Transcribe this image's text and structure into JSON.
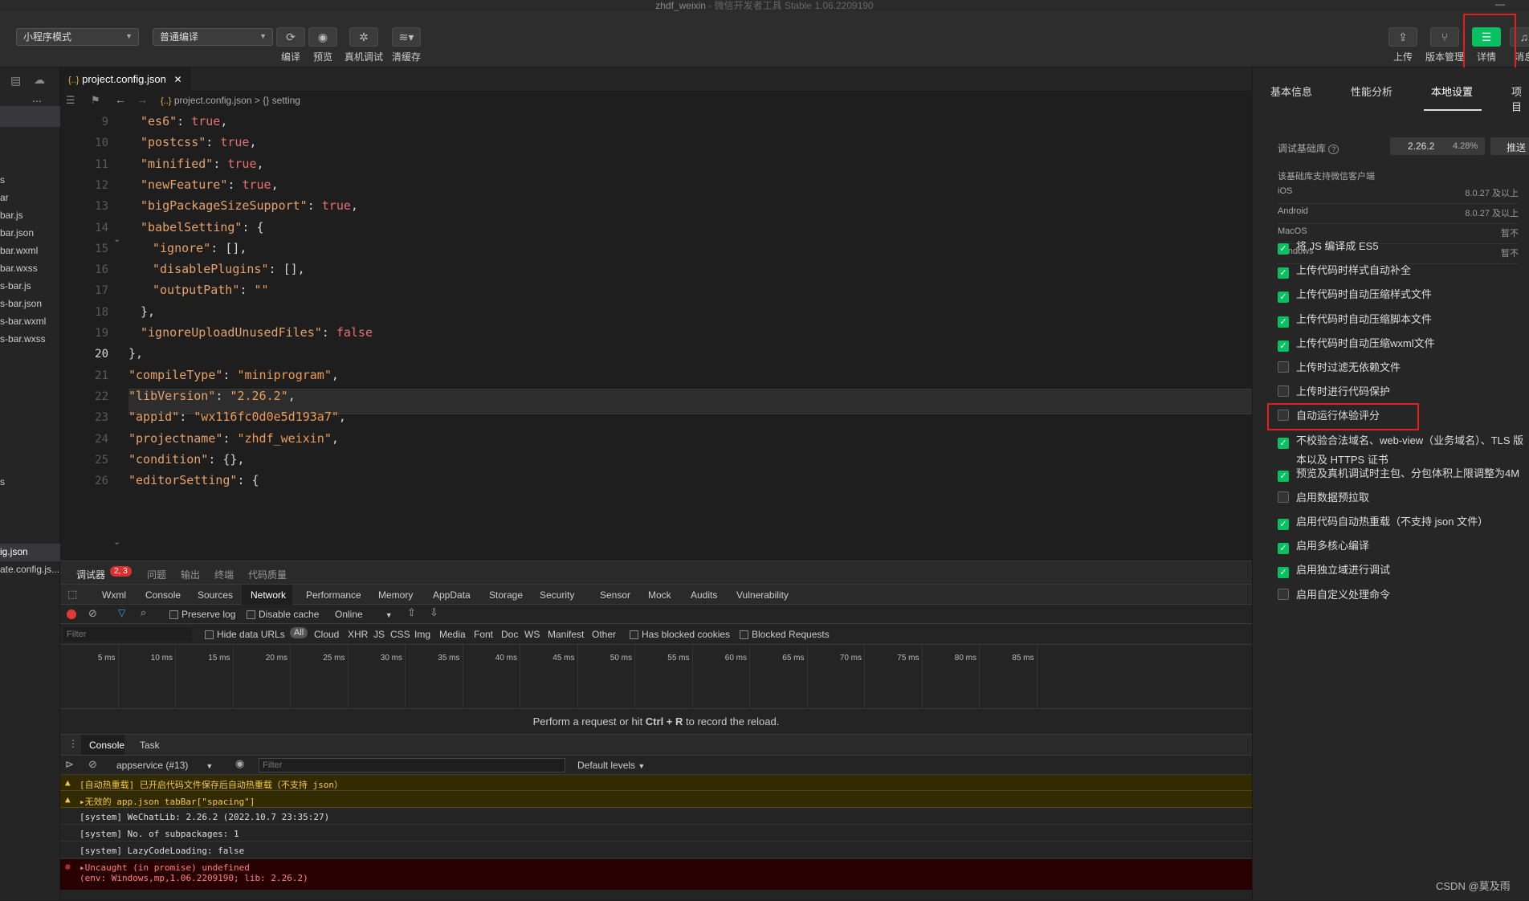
{
  "titlebar": {
    "project": "zhdf_weixin",
    "sep": " - ",
    "app": "微信开发者工具 Stable 1.06.2209190",
    "min_icon": "—"
  },
  "toolbar": {
    "mode_select": "小程序模式",
    "compile_select": "普通编译",
    "buttons": [
      {
        "label": "编译",
        "icon": "refresh-icon"
      },
      {
        "label": "预览",
        "icon": "eye-icon"
      },
      {
        "label": "真机调试",
        "icon": "bug-icon"
      },
      {
        "label": "清缓存",
        "icon": "layers-icon"
      }
    ],
    "right_buttons": [
      {
        "label": "上传",
        "icon": "upload-icon"
      },
      {
        "label": "版本管理",
        "icon": "branch-icon"
      },
      {
        "label": "详情",
        "icon": "menu-icon"
      },
      {
        "label": "消息",
        "icon": "bell-icon"
      }
    ]
  },
  "sidebar": {
    "dots": "...",
    "files": [
      "s",
      "ar",
      "bar.js",
      "bar.json",
      "bar.wxml",
      "bar.wxss",
      "s-bar.js",
      "s-bar.json",
      "s-bar.wxml",
      "s-bar.wxss",
      "s",
      "ig.json",
      "ate.config.js..."
    ]
  },
  "editor": {
    "tab": {
      "icon": "{..}",
      "name": "project.config.json",
      "close": "✕"
    },
    "breadcrumb": {
      "icon": "{..}",
      "file": "project.config.json",
      "sep": ">",
      "node_icon": "{}",
      "node": "setting"
    },
    "line_numbers": [
      "9",
      "10",
      "11",
      "12",
      "13",
      "14",
      "15",
      "16",
      "17",
      "18",
      "19",
      "20",
      "21",
      "22",
      "23",
      "24",
      "25",
      "26"
    ],
    "lines": [
      {
        "indent": 2,
        "key": "\"es6\"",
        "colon": ": ",
        "val": "true",
        "tail": ","
      },
      {
        "indent": 2,
        "key": "\"postcss\"",
        "colon": ": ",
        "val": "true",
        "tail": ","
      },
      {
        "indent": 2,
        "key": "\"minified\"",
        "colon": ": ",
        "val": "true",
        "tail": ","
      },
      {
        "indent": 2,
        "key": "\"newFeature\"",
        "colon": ": ",
        "val": "true",
        "tail": ","
      },
      {
        "indent": 2,
        "key": "\"bigPackageSizeSupport\"",
        "colon": ": ",
        "val": "true",
        "tail": ","
      },
      {
        "indent": 2,
        "key": "\"babelSetting\"",
        "colon": ": ",
        "val": "{",
        "tail": ""
      },
      {
        "indent": 3,
        "key": "\"ignore\"",
        "colon": ": ",
        "val": "[]",
        "tail": ","
      },
      {
        "indent": 3,
        "key": "\"disablePlugins\"",
        "colon": ": ",
        "val": "[]",
        "tail": ","
      },
      {
        "indent": 3,
        "key": "\"outputPath\"",
        "colon": ": ",
        "val": "\"\"",
        "tail": ""
      },
      {
        "indent": 2,
        "key": "",
        "colon": "",
        "val": "",
        "tail": "},"
      },
      {
        "indent": 2,
        "key": "\"ignoreUploadUnusedFiles\"",
        "colon": ": ",
        "val": "false",
        "tail": ""
      },
      {
        "indent": 1,
        "key": "",
        "colon": "",
        "val": "",
        "tail": "},"
      },
      {
        "indent": 1,
        "key": "\"compileType\"",
        "colon": ": ",
        "val": "\"miniprogram\"",
        "tail": ","
      },
      {
        "indent": 1,
        "key": "\"libVersion\"",
        "colon": ": ",
        "val": "\"2.26.2\"",
        "tail": ","
      },
      {
        "indent": 1,
        "key": "\"appid\"",
        "colon": ": ",
        "val": "\"wx116fc0d0e5d193a7\"",
        "tail": ","
      },
      {
        "indent": 1,
        "key": "\"projectname\"",
        "colon": ": ",
        "val": "\"zhdf_weixin\"",
        "tail": ","
      },
      {
        "indent": 1,
        "key": "\"condition\"",
        "colon": ": ",
        "val": "{}",
        "tail": ","
      },
      {
        "indent": 1,
        "key": "\"editorSetting\"",
        "colon": ": ",
        "val": "{",
        "tail": ""
      }
    ]
  },
  "devtools": {
    "top_tabs": [
      "调试器",
      "问题",
      "输出",
      "终端",
      "代码质量"
    ],
    "badge": "2, 3",
    "panel_tabs": [
      "Wxml",
      "Console",
      "Sources",
      "Network",
      "Performance",
      "Memory",
      "AppData",
      "Storage",
      "Security",
      "Sensor",
      "Mock",
      "Audits",
      "Vulnerability"
    ],
    "network": {
      "preserve_log": "Preserve log",
      "disable_cache": "Disable cache",
      "throttle": "Online",
      "filter_placeholder": "Filter",
      "hide_data_urls": "Hide data URLs",
      "types": [
        "All",
        "Cloud",
        "XHR",
        "JS",
        "CSS",
        "Img",
        "Media",
        "Font",
        "Doc",
        "WS",
        "Manifest",
        "Other"
      ],
      "has_blocked": "Has blocked cookies",
      "blocked_requests": "Blocked Requests",
      "ticks": [
        "5 ms",
        "10 ms",
        "15 ms",
        "20 ms",
        "25 ms",
        "30 ms",
        "35 ms",
        "40 ms",
        "45 ms",
        "50 ms",
        "55 ms",
        "60 ms",
        "65 ms",
        "70 ms",
        "75 ms",
        "80 ms",
        "85 ms"
      ],
      "hint_pre": "Perform a request or hit ",
      "hint_key": "Ctrl + R",
      "hint_post": " to record the reload."
    },
    "drawer_tabs": [
      "Console",
      "Task"
    ],
    "console": {
      "context": "appservice (#13)",
      "filter_placeholder": "Filter",
      "levels": "Default levels",
      "messages": [
        {
          "type": "warn",
          "text": "[自动热重载] 已开启代码文件保存后自动热重载（不支持 json）"
        },
        {
          "type": "warn",
          "text": "▸无效的 app.json tabBar[\"spacing\"]"
        },
        {
          "type": "info",
          "text": "[system] WeChatLib: 2.26.2 (2022.10.7 23:35:27)"
        },
        {
          "type": "info",
          "text": "[system] No. of subpackages: 1"
        },
        {
          "type": "info",
          "text": "[system] LazyCodeLoading: false"
        },
        {
          "type": "error",
          "text": "▸Uncaught (in promise) undefined\n(env: Windows,mp,1.06.2209190; lib: 2.26.2)"
        }
      ]
    }
  },
  "details": {
    "tabs": [
      "基本信息",
      "性能分析",
      "本地设置",
      "项目"
    ],
    "lib_label": "调试基础库",
    "lib_version": "2.26.2",
    "lib_percent": "4.28%",
    "push_button": "推送",
    "support_title": "该基础库支持微信客户端",
    "platforms": [
      {
        "name": "iOS",
        "val": "8.0.27 及以上"
      },
      {
        "name": "Android",
        "val": "8.0.27 及以上"
      },
      {
        "name": "MacOS",
        "val": "暂不"
      },
      {
        "name": "Windows",
        "val": "暂不"
      }
    ],
    "options": [
      {
        "label": "将 JS 编译成 ES5",
        "checked": true
      },
      {
        "label": "上传代码时样式自动补全",
        "checked": true
      },
      {
        "label": "上传代码时自动压缩样式文件",
        "checked": true
      },
      {
        "label": "上传代码时自动压缩脚本文件",
        "checked": true
      },
      {
        "label": "上传代码时自动压缩wxml文件",
        "checked": true
      },
      {
        "label": "上传时过滤无依赖文件",
        "checked": false
      },
      {
        "label": "上传时进行代码保护",
        "checked": false
      },
      {
        "label": "自动运行体验评分",
        "checked": false
      },
      {
        "label": "不校验合法域名、web-view（业务域名）、TLS 版",
        "label2": "本以及 HTTPS 证书",
        "checked": true
      },
      {
        "label": "预览及真机调试时主包、分包体积上限调整为4M",
        "checked": true
      },
      {
        "label": "启用数据预拉取",
        "checked": false
      },
      {
        "label": "启用代码自动热重载（不支持 json 文件）",
        "checked": true
      },
      {
        "label": "启用多核心编译",
        "checked": true
      },
      {
        "label": "启用独立域进行调试",
        "checked": true
      },
      {
        "label": "启用自定义处理命令",
        "checked": false
      }
    ]
  },
  "watermark": "CSDN @莫及雨",
  "colors": {
    "accent": "#07c160",
    "highlight": "#e02020"
  }
}
